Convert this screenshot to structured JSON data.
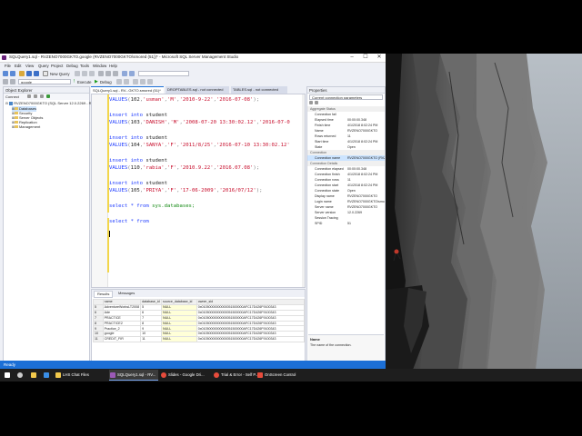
{
  "window": {
    "title": "SQLQuery1.sql - RVZENO7000GKTO.google (RVZENO7000GKTO\\smored (51))* - Microsoft SQL Server Management Studio",
    "controls": [
      "–",
      "☐",
      "✕"
    ]
  },
  "menu": [
    "File",
    "Edit",
    "View",
    "Query",
    "Project",
    "Debug",
    "Tools",
    "Window",
    "Help"
  ],
  "toolbar": {
    "new_query": "New Query",
    "database": "google",
    "execute": "Execute",
    "debug": "Debug"
  },
  "object_explorer": {
    "title": "Object Explorer",
    "connect": "Connect",
    "server": "RVZENO7000GKTO (SQL Server 12.0.2269 - R",
    "items": [
      "Databases",
      "Security",
      "Server Objects",
      "Replication",
      "Management"
    ]
  },
  "tabs": [
    {
      "label": "SQLQuery1.sql - RV...GKTO.smored (51)*",
      "active": true
    },
    {
      "label": "DROPTABLES.sql - not connected",
      "active": false
    },
    {
      "label": "TABLES.sql - not connected",
      "active": false
    }
  ],
  "editor": {
    "lines": [
      {
        "type": "values",
        "num": "102",
        "parts": [
          "'usman'",
          "'M'",
          "'2010-9-22'",
          "'2016-07-08'"
        ],
        "close": ");"
      },
      {
        "type": "insert"
      },
      {
        "type": "values",
        "num": "103",
        "parts": [
          "'DANISH'",
          "'M'",
          "'2008-07-20 13:30:02.12'",
          "'2016-07-0"
        ],
        "close": ""
      },
      {
        "type": "insert"
      },
      {
        "type": "values",
        "num": "104",
        "parts": [
          "'SANYA'",
          "'F'",
          "'2011/8/25'",
          "'2016-07-10 13:30:02.12'"
        ],
        "close": ""
      },
      {
        "type": "insert"
      },
      {
        "type": "values",
        "num": "110",
        "parts": [
          "'rabia'",
          "'F'",
          "'2010.9.22'",
          "'2016.07.08'"
        ],
        "close": ");"
      },
      {
        "type": "insert"
      },
      {
        "type": "values",
        "num": "105",
        "parts": [
          "'PRIYA'",
          "'F'",
          "'17-06-2009'",
          "'2016/07/12'"
        ],
        "close": ");"
      },
      {
        "type": "select_db"
      },
      {
        "type": "select_from"
      }
    ],
    "kw_insert": "insert into",
    "kw_values": "VALUES",
    "table": "student",
    "kw_select": "select * from",
    "sysdb": "sys.databases;"
  },
  "results": {
    "tabs": [
      "Results",
      "Messages"
    ],
    "columns": [
      "",
      "name",
      "database_id",
      "source_database_id",
      "owner_sid"
    ],
    "rows": [
      [
        "5",
        "AdventureWorksLT2008",
        "5",
        "NULL",
        "0x01050000000000051500000AFC17D426F9100343"
      ],
      [
        "6",
        "Ade",
        "6",
        "NULL",
        "0x01050000000000051500000AFC17D426F9100343"
      ],
      [
        "7",
        "PRACTICE",
        "7",
        "NULL",
        "0x01050000000000051500000AFC17D426F9100343"
      ],
      [
        "8",
        "PRACTICE2",
        "8",
        "NULL",
        "0x01050000000000051500000AFC17D426F9100343"
      ],
      [
        "9",
        "Practice_2",
        "9",
        "NULL",
        "0x01050000000000051500000AFC17D426F9100343"
      ],
      [
        "10",
        "google",
        "10",
        "NULL",
        "0x01050000000000051500000AFC17D426F9100343"
      ],
      [
        "11",
        "CREDIT_FIR",
        "11",
        "NULL",
        "0x01050000000000051500000AFC17D426F9100343"
      ]
    ]
  },
  "query_status": {
    "message": "Query executed successfully.",
    "server": "RVZENO7000GKTO (12.0 RTM)",
    "user": "RVZENO7000GKTO\\smore...",
    "db": "google",
    "time": "00:00:00",
    "rows": "11 rows"
  },
  "properties": {
    "title": "Properties",
    "dropdown": "Current connection parameters",
    "rows": [
      {
        "k": "Aggregate Status",
        "v": "",
        "cat": true
      },
      {
        "k": "Connection fail",
        "v": ""
      },
      {
        "k": "Elapsed time",
        "v": "00:00:00.348"
      },
      {
        "k": "Finish time",
        "v": "4/1/2018 8:02:24 PM"
      },
      {
        "k": "Name",
        "v": "RVZENO7000GKTO"
      },
      {
        "k": "Rows returned",
        "v": "11"
      },
      {
        "k": "Start time",
        "v": "4/1/2018 8:02:24 PM"
      },
      {
        "k": "State",
        "v": "Open"
      },
      {
        "k": "Connection",
        "v": "",
        "cat": true
      },
      {
        "k": "Connection name",
        "v": "RVZENO7000GKTO (RVZENO7",
        "sel": true
      },
      {
        "k": "Connection Details",
        "v": "",
        "cat": true
      },
      {
        "k": "Connection elapsed",
        "v": "00:00:00.348"
      },
      {
        "k": "Connection finish",
        "v": "4/1/2018 8:02:24 PM"
      },
      {
        "k": "Connection rows",
        "v": "11"
      },
      {
        "k": "Connection start",
        "v": "4/1/2018 8:02:24 PM"
      },
      {
        "k": "Connection state",
        "v": "Open"
      },
      {
        "k": "Display name",
        "v": "RVZENO7000GKTO"
      },
      {
        "k": "Login name",
        "v": "RVZENO7000GKTO\\smored"
      },
      {
        "k": "Server name",
        "v": "RVZENO7000GKTO"
      },
      {
        "k": "Server version",
        "v": "12.0.2269"
      },
      {
        "k": "Session Tracing",
        "v": ""
      },
      {
        "k": "SPID",
        "v": "51"
      }
    ],
    "desc_title": "Name",
    "desc": "The name of the connection."
  },
  "statusbar": "Ready",
  "taskbar": [
    {
      "label": "",
      "color": "#ffffff"
    },
    {
      "label": "",
      "color": "#cccccc"
    },
    {
      "label": "",
      "color": "#f2c94c"
    },
    {
      "label": "",
      "color": "#3a8ee6"
    },
    {
      "label": "LHS Chat Files",
      "color": "#f2c94c"
    },
    {
      "label": "SQLQuery1.sql - RV...",
      "color": "#9b59b6"
    },
    {
      "label": "Slides - Google Dri...",
      "color": "#e74c3c"
    },
    {
      "label": "Trial & Error - Self P...",
      "color": "#e74c3c"
    },
    {
      "label": "OnScreen Control",
      "color": "#e74c3c"
    }
  ]
}
